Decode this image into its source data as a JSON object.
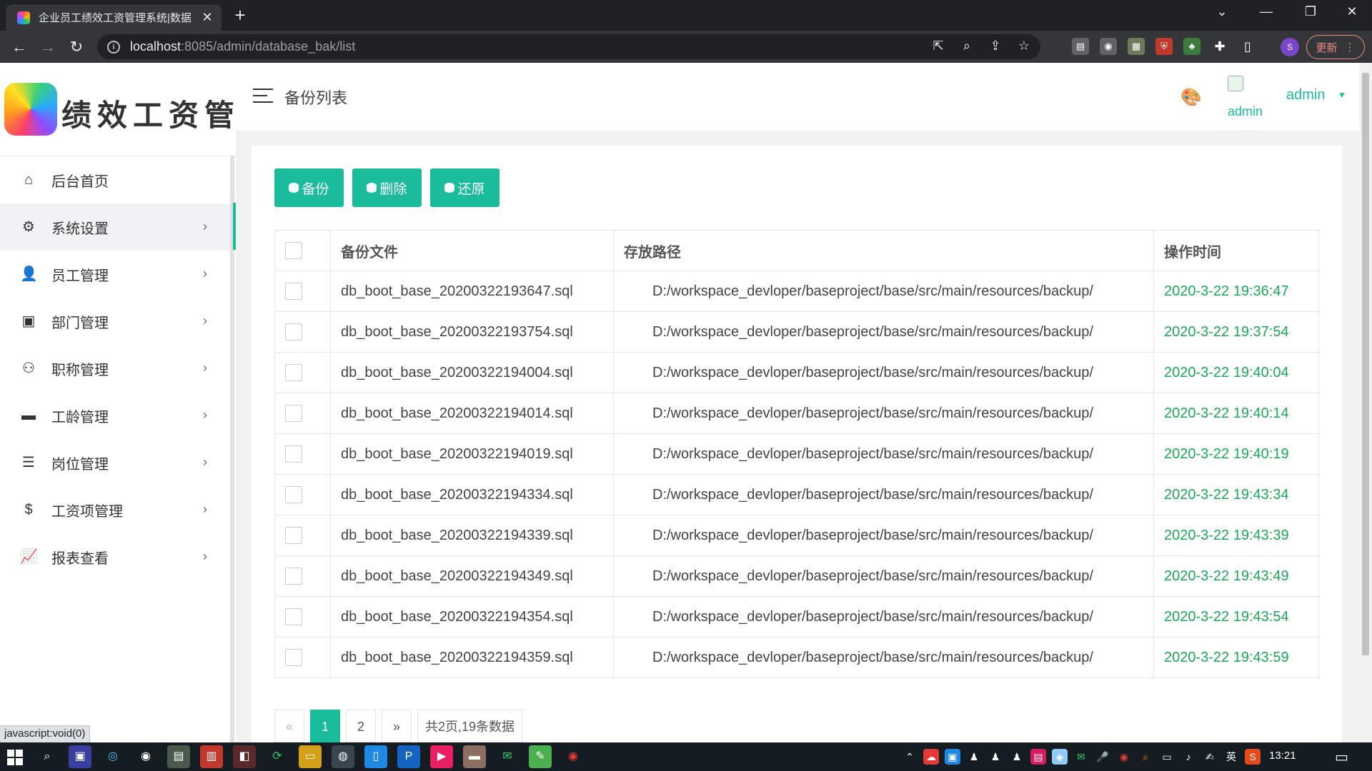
{
  "browser": {
    "tab_title": "企业员工绩效工资管理系统|数据",
    "tab_close": "✕",
    "new_tab": "+",
    "url_host": "localhost",
    "url_path": ":8085/admin/database_bak/list",
    "update_label": "更新",
    "profile_initial": "S",
    "window_controls": [
      "⌄",
      "—",
      "❐",
      "✕"
    ]
  },
  "app": {
    "logo_text": "绩效工资管理",
    "header_title": "备份列表",
    "avatar_alt": "admin",
    "user_name": "admin"
  },
  "sidebar": {
    "items": [
      {
        "label": "后台首页",
        "icon": "home-icon",
        "glyph": "⌂",
        "has_arrow": false
      },
      {
        "label": "系统设置",
        "icon": "gear-icon",
        "glyph": "⚙",
        "has_arrow": true
      },
      {
        "label": "员工管理",
        "icon": "user-icon",
        "glyph": "👤",
        "has_arrow": true
      },
      {
        "label": "部门管理",
        "icon": "calendar-icon",
        "glyph": "▣",
        "has_arrow": true
      },
      {
        "label": "职称管理",
        "icon": "user-settings-icon",
        "glyph": "⚇",
        "has_arrow": true
      },
      {
        "label": "工龄管理",
        "icon": "wallet-icon",
        "glyph": "▬",
        "has_arrow": true
      },
      {
        "label": "岗位管理",
        "icon": "list-icon",
        "glyph": "☰",
        "has_arrow": true
      },
      {
        "label": "工资项管理",
        "icon": "dollar-icon",
        "glyph": "$",
        "has_arrow": true
      },
      {
        "label": "报表查看",
        "icon": "chart-icon",
        "glyph": "📈",
        "has_arrow": true
      }
    ],
    "arrow": "›"
  },
  "toolbar": {
    "backup_label": "备份",
    "delete_label": "删除",
    "restore_label": "还原"
  },
  "table": {
    "headers": {
      "file": "备份文件",
      "path": "存放路径",
      "time": "操作时间"
    },
    "rows": [
      {
        "file": "db_boot_base_20200322193647.sql",
        "path": "D:/workspace_devloper/baseproject/base/src/main/resources/backup/",
        "time": "2020-3-22 19:36:47"
      },
      {
        "file": "db_boot_base_20200322193754.sql",
        "path": "D:/workspace_devloper/baseproject/base/src/main/resources/backup/",
        "time": "2020-3-22 19:37:54"
      },
      {
        "file": "db_boot_base_20200322194004.sql",
        "path": "D:/workspace_devloper/baseproject/base/src/main/resources/backup/",
        "time": "2020-3-22 19:40:04"
      },
      {
        "file": "db_boot_base_20200322194014.sql",
        "path": "D:/workspace_devloper/baseproject/base/src/main/resources/backup/",
        "time": "2020-3-22 19:40:14"
      },
      {
        "file": "db_boot_base_20200322194019.sql",
        "path": "D:/workspace_devloper/baseproject/base/src/main/resources/backup/",
        "time": "2020-3-22 19:40:19"
      },
      {
        "file": "db_boot_base_20200322194334.sql",
        "path": "D:/workspace_devloper/baseproject/base/src/main/resources/backup/",
        "time": "2020-3-22 19:43:34"
      },
      {
        "file": "db_boot_base_20200322194339.sql",
        "path": "D:/workspace_devloper/baseproject/base/src/main/resources/backup/",
        "time": "2020-3-22 19:43:39"
      },
      {
        "file": "db_boot_base_20200322194349.sql",
        "path": "D:/workspace_devloper/baseproject/base/src/main/resources/backup/",
        "time": "2020-3-22 19:43:49"
      },
      {
        "file": "db_boot_base_20200322194354.sql",
        "path": "D:/workspace_devloper/baseproject/base/src/main/resources/backup/",
        "time": "2020-3-22 19:43:54"
      },
      {
        "file": "db_boot_base_20200322194359.sql",
        "path": "D:/workspace_devloper/baseproject/base/src/main/resources/backup/",
        "time": "2020-3-22 19:43:59"
      }
    ]
  },
  "pagination": {
    "prev": "«",
    "pages": [
      "1",
      "2"
    ],
    "current": "1",
    "next": "»",
    "summary": "共2页,19条数据"
  },
  "status_tip": "javascript:void(0)",
  "taskbar": {
    "clock": "13:21",
    "ime": "英"
  },
  "colors": {
    "accent": "#1abc9c",
    "time_text": "#1aaa55"
  }
}
